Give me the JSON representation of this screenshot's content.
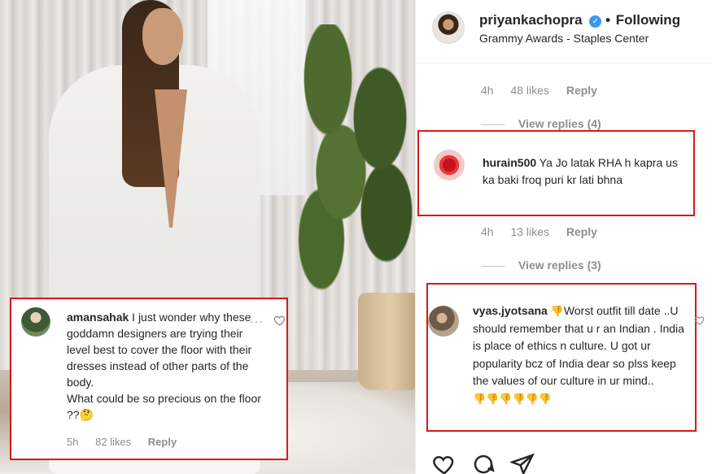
{
  "post": {
    "author": "priyankachopra",
    "follow_state": "Following",
    "location": "Grammy Awards - Staples Center"
  },
  "overlay_comment": {
    "username": "amansahak",
    "text": "I just wonder why these goddamn designers are trying their level best to cover the floor with their dresses instead of other parts of the body.",
    "text2": "What could be so precious on the floor ??🤔",
    "time": "5h",
    "likes": "82 likes",
    "reply": "Reply",
    "more": "···"
  },
  "comments": [
    {
      "time": "4h",
      "likes": "48 likes",
      "reply": "Reply",
      "view_replies": "View replies (4)"
    },
    {
      "username": "hurain500",
      "text": "Ya Jo latak RHA h kapra us ka baki froq puri kr lati bhna",
      "time": "4h",
      "likes": "13 likes",
      "reply": "Reply",
      "view_replies": "View replies (3)"
    },
    {
      "username": "vyas.jyotsana",
      "emoji_lead": "👎",
      "text": "Worst outfit till date ..U should remember that u r an Indian . India is place of ethics n culture. U got ur popularity bcz of India dear so plss keep the values of our culture in ur mind..",
      "emoji_tail": "👎👎👎👎👎👎"
    }
  ],
  "icons": {
    "verified": "verified-badge-icon",
    "heart": "heart-icon",
    "comment": "comment-icon",
    "share": "share-icon"
  },
  "colors": {
    "highlight_border": "#d61a1a",
    "verified_blue": "#3897f0",
    "muted_text": "#8e8e8e"
  }
}
